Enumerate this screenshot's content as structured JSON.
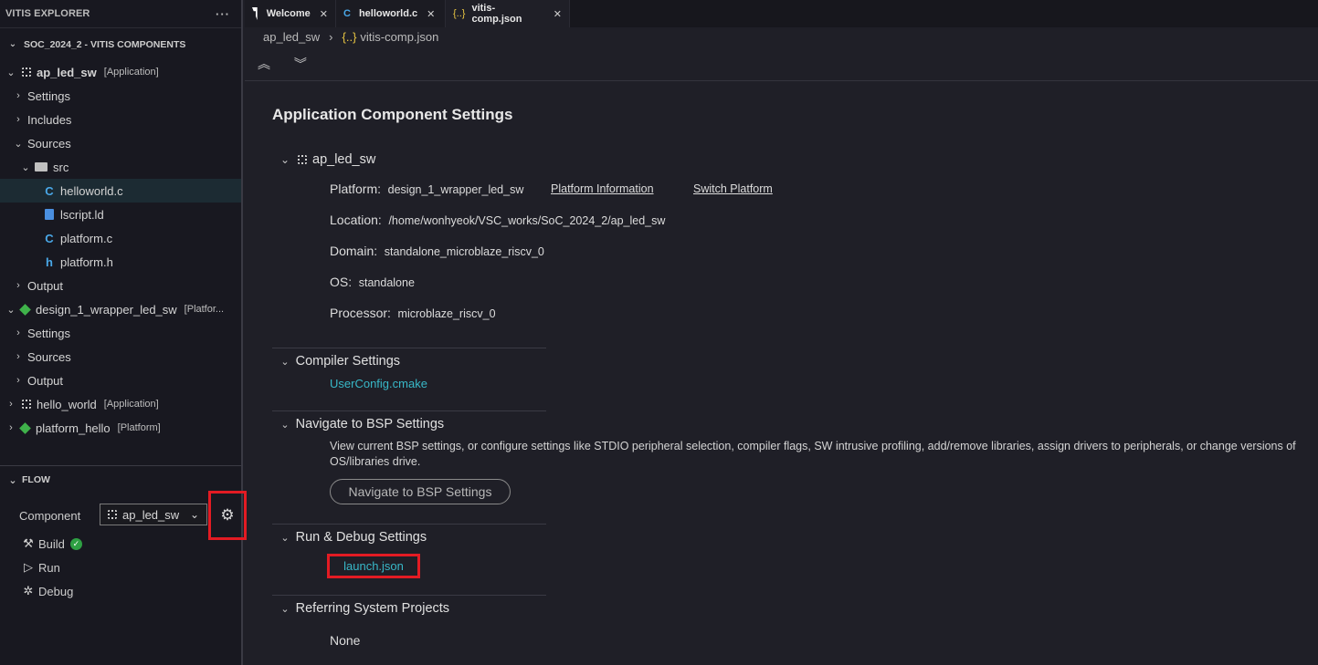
{
  "sidebar": {
    "title": "VITIS EXPLORER",
    "more": "···",
    "components_header": "SOC_2024_2 - VITIS COMPONENTS",
    "tree": {
      "ap_led_sw": {
        "label": "ap_led_sw",
        "tag": "[Application]"
      },
      "settings": "Settings",
      "includes": "Includes",
      "sources": "Sources",
      "src": "src",
      "helloworld": "helloworld.c",
      "lscript": "lscript.ld",
      "platform_c": "platform.c",
      "platform_h": "platform.h",
      "output": "Output",
      "design": {
        "label": "design_1_wrapper_led_sw",
        "tag": "[Platfor..."
      },
      "design_settings": "Settings",
      "design_sources": "Sources",
      "design_output": "Output",
      "hello_world": {
        "label": "hello_world",
        "tag": "[Application]"
      },
      "platform_hello": {
        "label": "platform_hello",
        "tag": "[Platform]"
      }
    },
    "flow": {
      "header": "FLOW",
      "component_label": "Component",
      "component_value": "ap_led_sw",
      "build": "Build",
      "run": "Run",
      "debug": "Debug"
    },
    "icons": {
      "c": "C",
      "h": "h"
    }
  },
  "tabs": [
    {
      "label": "Welcome"
    },
    {
      "label": "helloworld.c"
    },
    {
      "label": "vitis-comp.json"
    }
  ],
  "breadcrumb": {
    "part1": "ap_led_sw",
    "part2": "vitis-comp.json",
    "json_icon": "{..}"
  },
  "main": {
    "title": "Application Component Settings",
    "component_name": "ap_led_sw",
    "platform_label": "Platform:",
    "platform_value": "design_1_wrapper_led_sw",
    "platform_info_link": "Platform Information",
    "switch_platform_link": "Switch Platform",
    "location_label": "Location:",
    "location_value": "/home/wonhyeok/VSC_works/SoC_2024_2/ap_led_sw",
    "domain_label": "Domain:",
    "domain_value": "standalone_microblaze_riscv_0",
    "os_label": "OS:",
    "os_value": "standalone",
    "processor_label": "Processor:",
    "processor_value": "microblaze_riscv_0",
    "compiler_title": "Compiler Settings",
    "compiler_link": "UserConfig.cmake",
    "bsp_title": "Navigate to BSP Settings",
    "bsp_desc": "View current BSP settings, or configure settings like STDIO peripheral selection, compiler flags, SW intrusive profiling, add/remove libraries, assign drivers to peripherals, or change versions of OS/libraries drive.",
    "bsp_button": "Navigate to BSP Settings",
    "run_debug_title": "Run & Debug Settings",
    "launch_link": "launch.json",
    "referring_title": "Referring System Projects",
    "referring_value": "None"
  },
  "colors": {
    "highlight_box": "#e31b23",
    "link_teal": "#38b8c8",
    "build_ok": "#2ea043"
  }
}
